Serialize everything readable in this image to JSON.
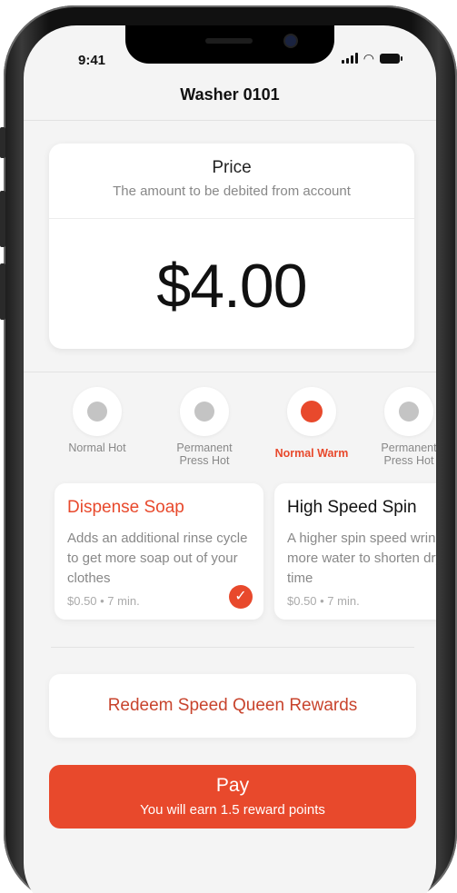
{
  "status_bar": {
    "time": "9:41"
  },
  "header": {
    "title": "Washer 0101"
  },
  "price": {
    "title": "Price",
    "subtitle": "The amount to be debited from account",
    "amount": "$4.00"
  },
  "cycles": [
    {
      "label_line1": "Normal Hot",
      "label_line2": "",
      "selected": false
    },
    {
      "label_line1": "Permanent",
      "label_line2": "Press Hot",
      "selected": false
    },
    {
      "label_line1": "Normal Warm",
      "label_line2": "",
      "selected": true
    },
    {
      "label_line1": "Permanent",
      "label_line2": "Press Hot",
      "selected": false
    }
  ],
  "options": [
    {
      "title": "Dispense Soap",
      "description": "Adds an additional rinse cycle to get more soap out of your clothes",
      "meta": "$0.50 • 7 min.",
      "selected": true,
      "icon": "check-icon"
    },
    {
      "title": "High Speed Spin",
      "description": "A higher spin speed wrings out more water to shorten drying time",
      "meta": "$0.50 • 7 min.",
      "selected": false
    }
  ],
  "rewards": {
    "label": "Redeem Speed Queen Rewards"
  },
  "pay": {
    "label": "Pay",
    "sublabel": "You will earn 1.5 reward points"
  },
  "colors": {
    "accent": "#e8492c",
    "background": "#f4f4f4",
    "card": "#ffffff",
    "muted_text": "#888888"
  }
}
